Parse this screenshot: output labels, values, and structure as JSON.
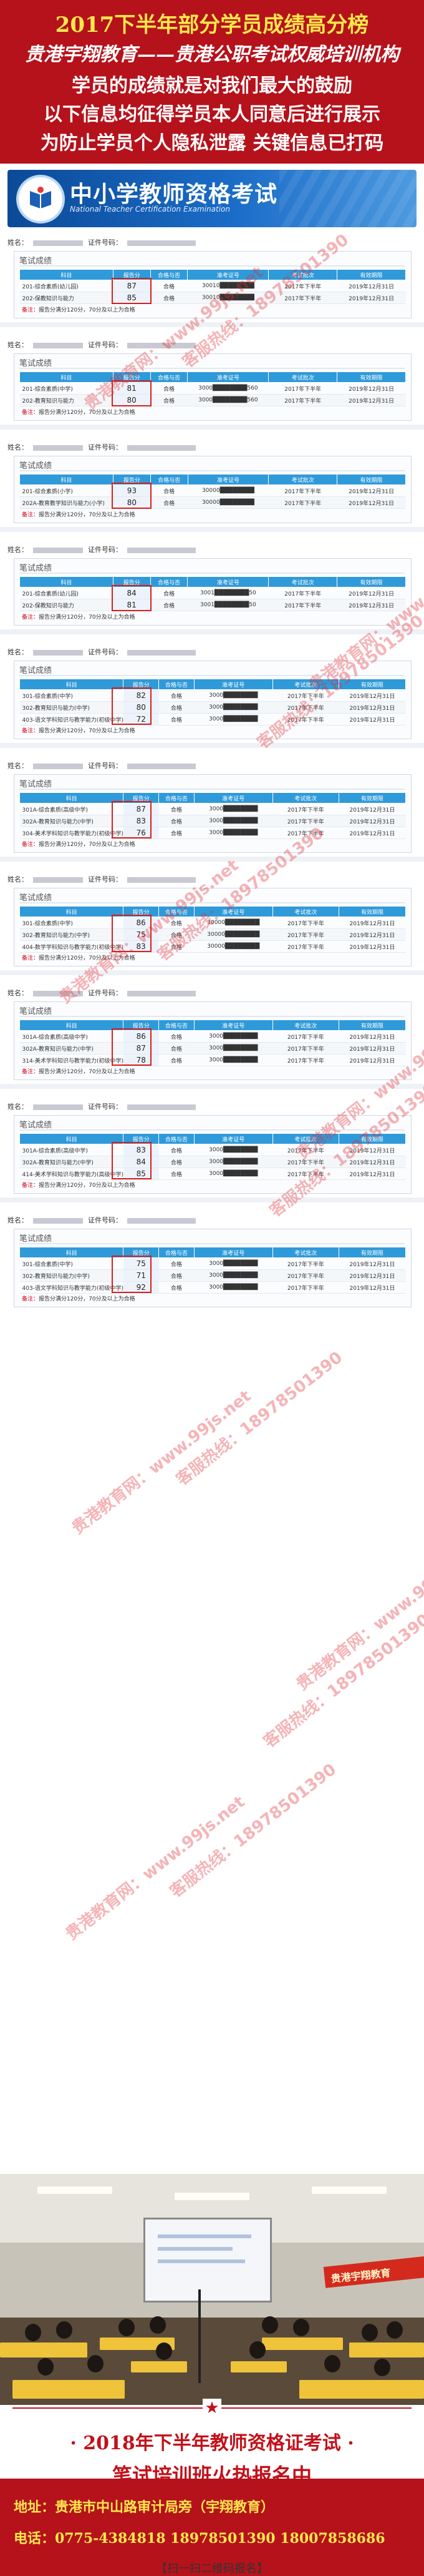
{
  "header": {
    "title": "2017下半年部分学员成绩高分榜",
    "subtitle": "贵港宇翔教育——贵港公职考试权威培训机构",
    "lines": [
      "学员的成绩就是对我们最大的鼓励",
      "以下信息均征得学员本人同意后进行展示",
      "为防止学员个人隐私泄露 关键信息已打码"
    ]
  },
  "banner": {
    "title": "中小学教师资格考试",
    "subtitle_en": "National Teacher Certification Examination"
  },
  "record_labels": {
    "name": "姓名：",
    "id": "证件号码：",
    "card_title": "笔试成绩",
    "columns": [
      "科目",
      "报告分",
      "合格与否",
      "准考证号",
      "考试批次",
      "有效期限"
    ],
    "note_prefix": "备注：",
    "note_text": "报告分满分120分，70分及以上为合格"
  },
  "records": [
    {
      "rows": [
        {
          "subject": "201-综合素质(幼儿园)",
          "score": "87",
          "pass": "合格",
          "ticket": "30010████████",
          "batch": "2017年下半年",
          "valid": "2019年12月31日"
        },
        {
          "subject": "202-保教知识与能力",
          "score": "85",
          "pass": "合格",
          "ticket": "30010████████",
          "batch": "2017年下半年",
          "valid": "2019年12月31日"
        }
      ]
    },
    {
      "rows": [
        {
          "subject": "201-综合素质(中学)",
          "score": "81",
          "pass": "合格",
          "ticket": "3000████████560",
          "batch": "2017年下半年",
          "valid": "2019年12月31日"
        },
        {
          "subject": "202-教育知识与能力",
          "score": "80",
          "pass": "合格",
          "ticket": "3000████████560",
          "batch": "2017年下半年",
          "valid": "2019年12月31日"
        }
      ]
    },
    {
      "rows": [
        {
          "subject": "201-综合素质(小学)",
          "score": "93",
          "pass": "合格",
          "ticket": "30000████████",
          "batch": "2017年下半年",
          "valid": "2019年12月31日"
        },
        {
          "subject": "202A-教育教学知识与能力(小学)",
          "score": "80",
          "pass": "合格",
          "ticket": "30000████████",
          "batch": "2017年下半年",
          "valid": "2019年12月31日"
        }
      ]
    },
    {
      "rows": [
        {
          "subject": "201-综合素质(幼儿园)",
          "score": "84",
          "pass": "合格",
          "ticket": "3001████████50",
          "batch": "2017年下半年",
          "valid": "2019年12月31日"
        },
        {
          "subject": "202-保教知识与能力",
          "score": "81",
          "pass": "合格",
          "ticket": "3001████████50",
          "batch": "2017年下半年",
          "valid": "2019年12月31日"
        }
      ]
    },
    {
      "rows": [
        {
          "subject": "301-综合素质(中学)",
          "score": "82",
          "pass": "合格",
          "ticket": "3000████████",
          "batch": "2017年下半年",
          "valid": "2019年12月31日"
        },
        {
          "subject": "302-教育知识与能力(中学)",
          "score": "80",
          "pass": "合格",
          "ticket": "3000████████",
          "batch": "2017年下半年",
          "valid": "2019年12月31日"
        },
        {
          "subject": "403-语文学科知识与教学能力(初级中学)",
          "score": "72",
          "pass": "合格",
          "ticket": "3000████████",
          "batch": "2017年下半年",
          "valid": "2019年12月31日"
        }
      ]
    },
    {
      "rows": [
        {
          "subject": "301A-综合素质(高级中学)",
          "score": "87",
          "pass": "合格",
          "ticket": "3000████████",
          "batch": "2017年下半年",
          "valid": "2019年12月31日"
        },
        {
          "subject": "302A-教育知识与能力(中学)",
          "score": "83",
          "pass": "合格",
          "ticket": "3000████████",
          "batch": "2017年下半年",
          "valid": "2019年12月31日"
        },
        {
          "subject": "304-美术学科知识与教学能力(初级中学)",
          "score": "76",
          "pass": "合格",
          "ticket": "3000████████",
          "batch": "2017年下半年",
          "valid": "2019年12月31日"
        }
      ]
    },
    {
      "rows": [
        {
          "subject": "301-综合素质(中学)",
          "score": "86",
          "pass": "合格",
          "ticket": "30000████████",
          "batch": "2017年下半年",
          "valid": "2019年12月31日"
        },
        {
          "subject": "302-教育知识与能力(中学)",
          "score": "75",
          "pass": "合格",
          "ticket": "30000████████",
          "batch": "2017年下半年",
          "valid": "2019年12月31日"
        },
        {
          "subject": "404-数学学科知识与教学能力(初级中学)",
          "score": "83",
          "pass": "合格",
          "ticket": "30000████████",
          "batch": "2017年下半年",
          "valid": "2019年12月31日"
        }
      ]
    },
    {
      "rows": [
        {
          "subject": "301A-综合素质(高级中学)",
          "score": "86",
          "pass": "合格",
          "ticket": "3000████████",
          "batch": "2017年下半年",
          "valid": "2019年12月31日"
        },
        {
          "subject": "302A-教育知识与能力(中学)",
          "score": "87",
          "pass": "合格",
          "ticket": "3000████████",
          "batch": "2017年下半年",
          "valid": "2019年12月31日"
        },
        {
          "subject": "314-美术学科知识与教学能力(初级中学)",
          "score": "78",
          "pass": "合格",
          "ticket": "3000████████",
          "batch": "2017年下半年",
          "valid": "2019年12月31日"
        }
      ]
    },
    {
      "rows": [
        {
          "subject": "301A-综合素质(高级中学)",
          "score": "83",
          "pass": "合格",
          "ticket": "3000████████",
          "batch": "2017年下半年",
          "valid": "2019年12月31日"
        },
        {
          "subject": "302A-教育知识与能力(中学)",
          "score": "84",
          "pass": "合格",
          "ticket": "3000████████",
          "batch": "2017年下半年",
          "valid": "2019年12月31日"
        },
        {
          "subject": "414-美术学科知识与教学能力(高级中学)",
          "score": "85",
          "pass": "合格",
          "ticket": "3000████████",
          "batch": "2017年下半年",
          "valid": "2019年12月31日"
        }
      ]
    },
    {
      "rows": [
        {
          "subject": "301-综合素质(中学)",
          "score": "75",
          "pass": "合格",
          "ticket": "3000████████",
          "batch": "2017年下半年",
          "valid": "2019年12月31日"
        },
        {
          "subject": "302-教育知识与能力(中学)",
          "score": "71",
          "pass": "合格",
          "ticket": "3000████████",
          "batch": "2017年下半年",
          "valid": "2019年12月31日"
        },
        {
          "subject": "403-语文学科知识与教学能力(初级中学)",
          "score": "92",
          "pass": "合格",
          "ticket": "3000████████",
          "batch": "2017年下半年",
          "valid": "2019年12月31日"
        }
      ]
    }
  ],
  "watermarks": [
    "贵港教育网：www.99js.net",
    "客服热线：18978501390"
  ],
  "photo": {
    "banner_text": "贵港宇翔教育"
  },
  "footer": {
    "line1": "· 2018年下半年教师资格证考试 ·",
    "line2": "笔试培训班火热报名中",
    "scan": "【扫一扫二维码报名】",
    "address": "地址：贵港市中山路审计局旁（宇翔教育）",
    "phone": "电话：0775-4384818 18978501390 18007858686"
  },
  "colors": {
    "brand_red": "#b5121b",
    "highlight_yellow": "#fde74c",
    "table_blue": "#2f9ad9"
  }
}
